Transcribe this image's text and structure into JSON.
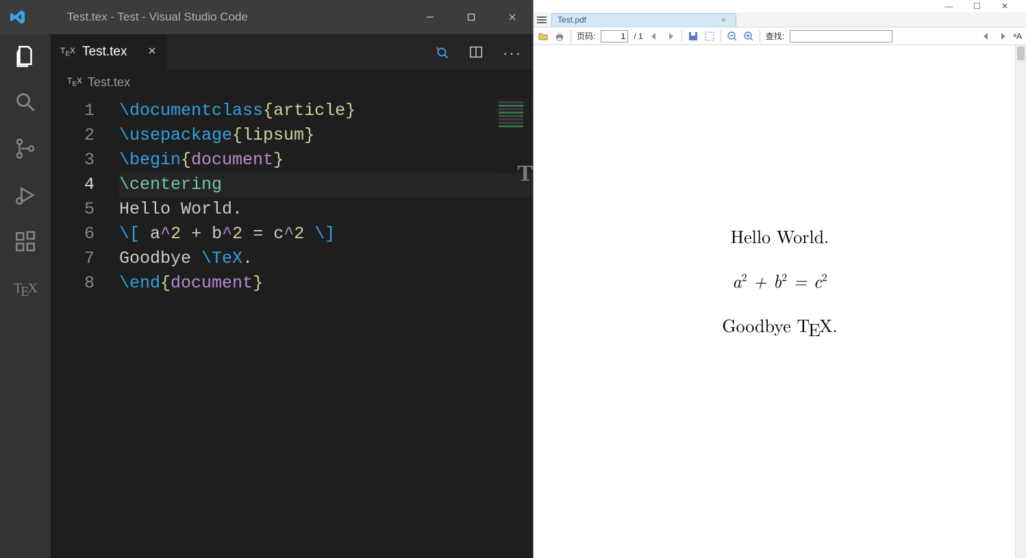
{
  "vscode": {
    "title": "Test.tex - Test - Visual Studio Code",
    "tab_label": "Test.tex",
    "breadcrumb": "Test.tex",
    "code_lines": [
      {
        "n": "1",
        "tokens": [
          [
            "cmd",
            "\\documentclass"
          ],
          [
            "brace",
            "{"
          ],
          [
            "arg",
            "article"
          ],
          [
            "brace",
            "}"
          ]
        ]
      },
      {
        "n": "2",
        "tokens": [
          [
            "cmd",
            "\\usepackage"
          ],
          [
            "brace",
            "{"
          ],
          [
            "arg",
            "lipsum"
          ],
          [
            "brace",
            "}"
          ]
        ]
      },
      {
        "n": "3",
        "tokens": [
          [
            "cmd",
            "\\begin"
          ],
          [
            "brace",
            "{"
          ],
          [
            "kw",
            "document"
          ],
          [
            "brace",
            "}"
          ]
        ]
      },
      {
        "n": "4",
        "tokens": [
          [
            "cent",
            "\\centering"
          ]
        ],
        "current": true
      },
      {
        "n": "5",
        "tokens": [
          [
            "text",
            "Hello World."
          ]
        ]
      },
      {
        "n": "6",
        "tokens": [
          [
            "math",
            "\\["
          ],
          [
            "text",
            " "
          ],
          [
            "text",
            "a"
          ],
          [
            "car",
            "^"
          ],
          [
            "num",
            "2"
          ],
          [
            "text",
            " "
          ],
          [
            "op",
            "+"
          ],
          [
            "text",
            " "
          ],
          [
            "text",
            "b"
          ],
          [
            "car",
            "^"
          ],
          [
            "num",
            "2"
          ],
          [
            "text",
            " "
          ],
          [
            "op",
            "="
          ],
          [
            "text",
            " "
          ],
          [
            "text",
            "c"
          ],
          [
            "car",
            "^"
          ],
          [
            "num",
            "2"
          ],
          [
            "text",
            " "
          ],
          [
            "math",
            "\\]"
          ]
        ]
      },
      {
        "n": "7",
        "tokens": [
          [
            "text",
            "Goodbye "
          ],
          [
            "cmd",
            "\\TeX"
          ],
          [
            "text",
            "."
          ]
        ]
      },
      {
        "n": "8",
        "tokens": [
          [
            "cmd",
            "\\end"
          ],
          [
            "brace",
            "{"
          ],
          [
            "kw",
            "document"
          ],
          [
            "brace",
            "}"
          ]
        ]
      }
    ]
  },
  "pdf": {
    "tab_label": "Test.pdf",
    "toolbar": {
      "page_label": "页码:",
      "page_current": "1",
      "page_sep": "/ 1",
      "find_label": "查找:",
      "text_size_label": "ᵃA"
    },
    "page": {
      "line1": "Hello World.",
      "math_a": "a",
      "math_b": "b",
      "math_c": "c",
      "sq": "2",
      "plus": " + ",
      "eq": " = ",
      "line3_pre": "Goodbye ",
      "line3_post": "."
    }
  }
}
